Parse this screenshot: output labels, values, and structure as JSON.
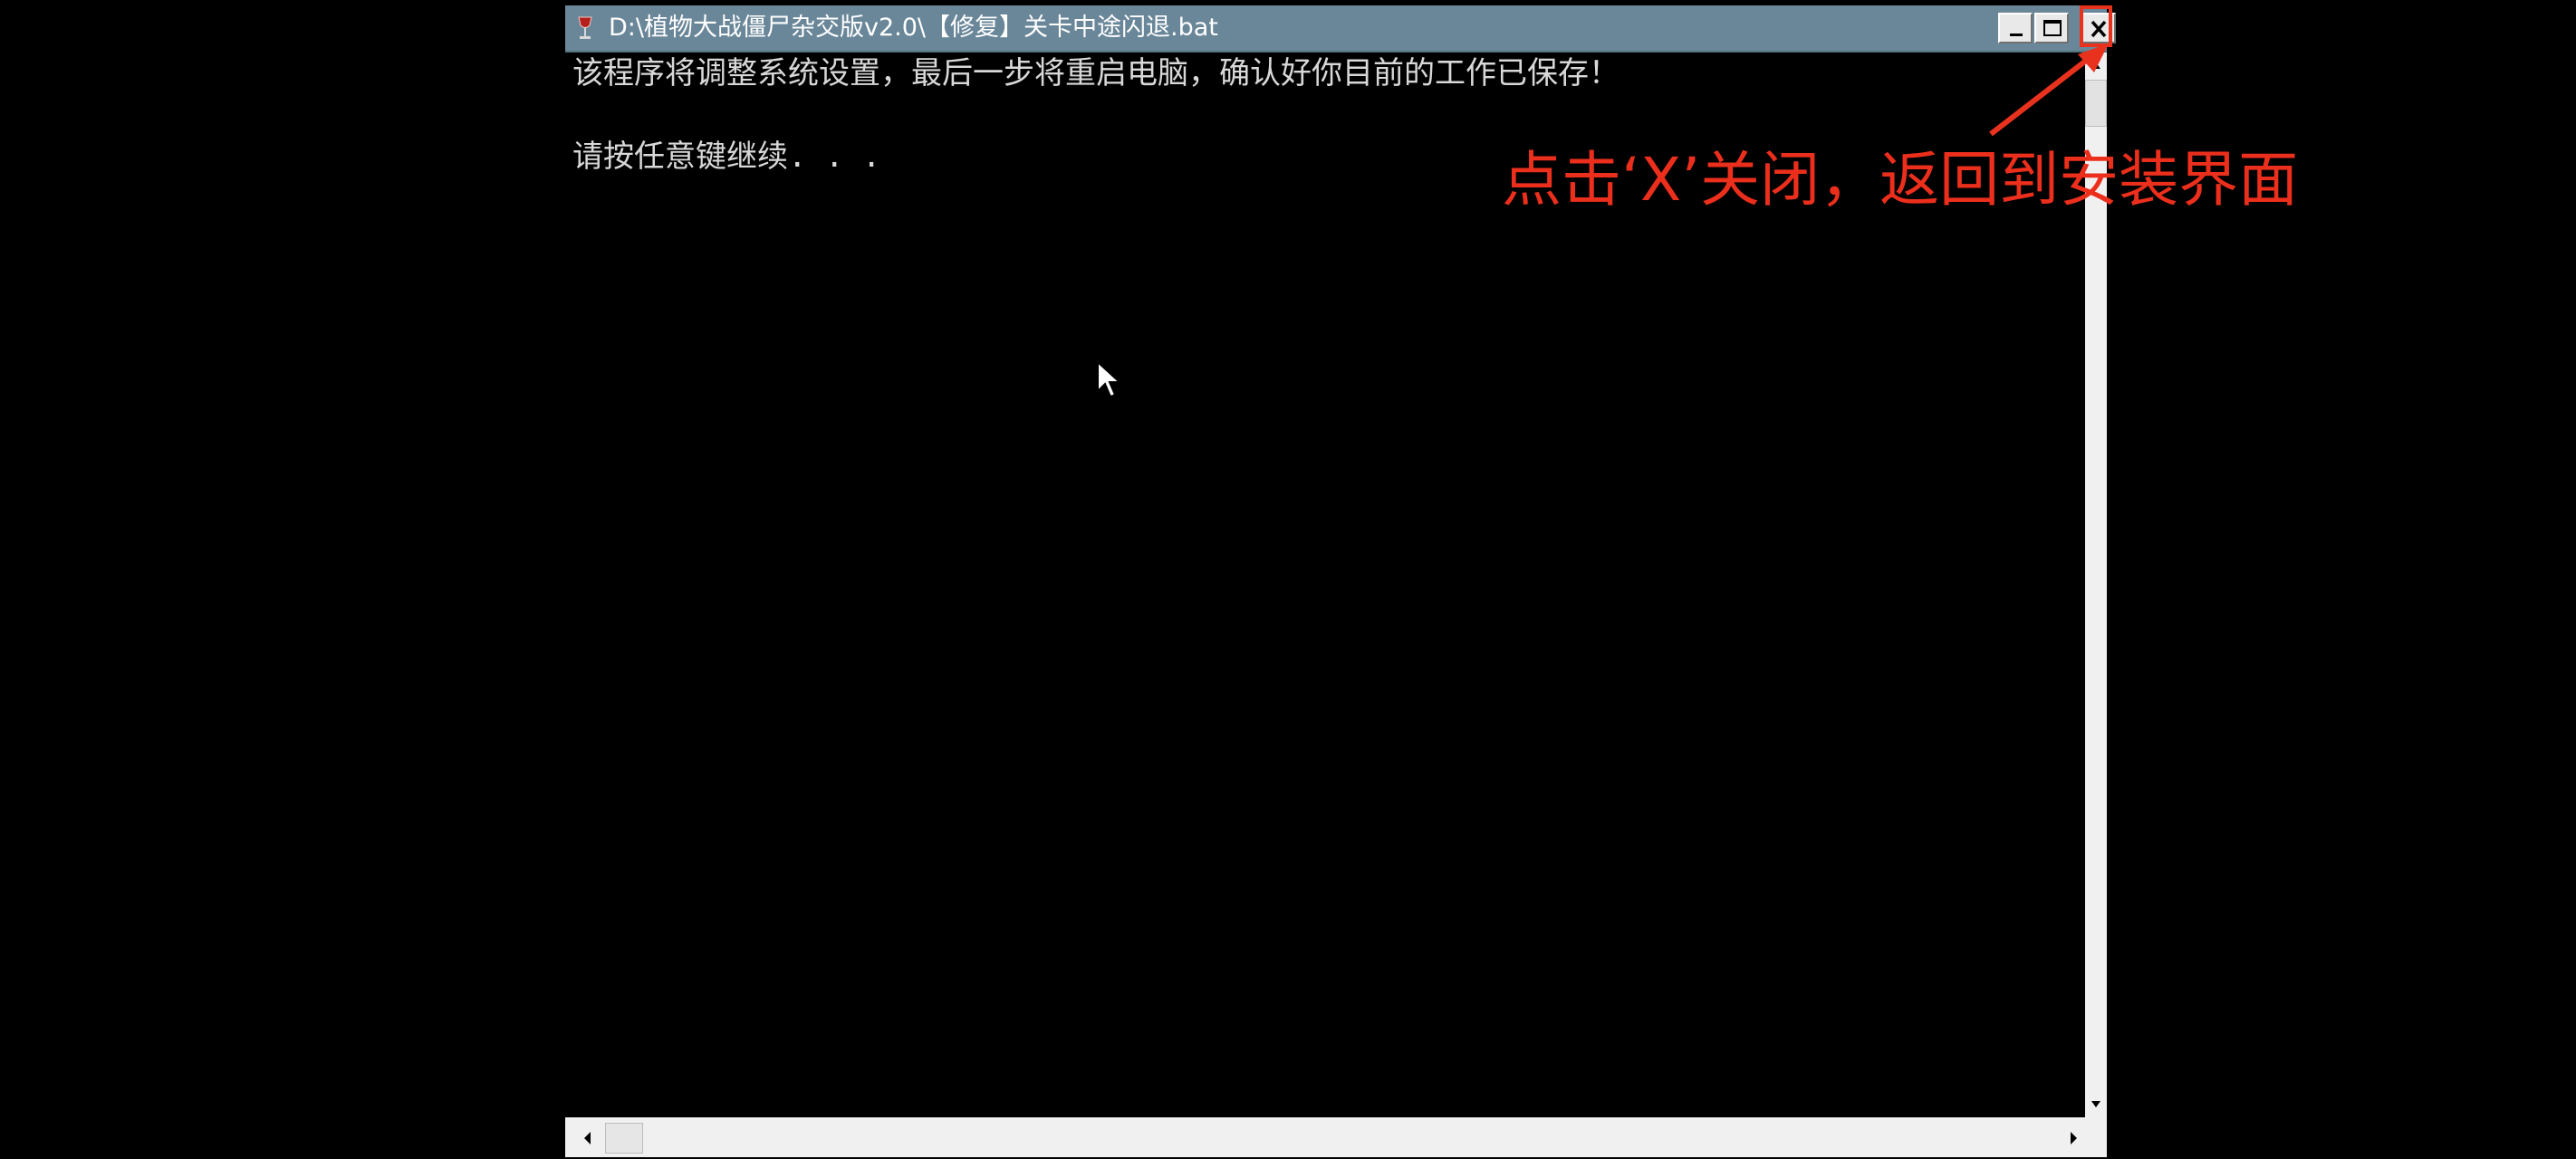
{
  "window": {
    "title": "D:\\植物大战僵尸杂交版v2.0\\【修复】关卡中途闪退.bat",
    "icon": "wine-glass-icon",
    "buttons": {
      "minimize": "minimize-icon",
      "maximize": "maximize-icon",
      "close": "close-icon"
    }
  },
  "console": {
    "lines": [
      "该程序将调整系统设置，最后一步将重启电脑，确认好你目前的工作已保存！",
      "",
      "请按任意键继续. . ."
    ]
  },
  "annotation": {
    "text": "点击‘X’关闭，返回到安装界面",
    "color": "#ec2f1c"
  },
  "colors": {
    "titlebar": "#6a8799",
    "console_bg": "#000000",
    "console_text": "#d8d8d8"
  }
}
